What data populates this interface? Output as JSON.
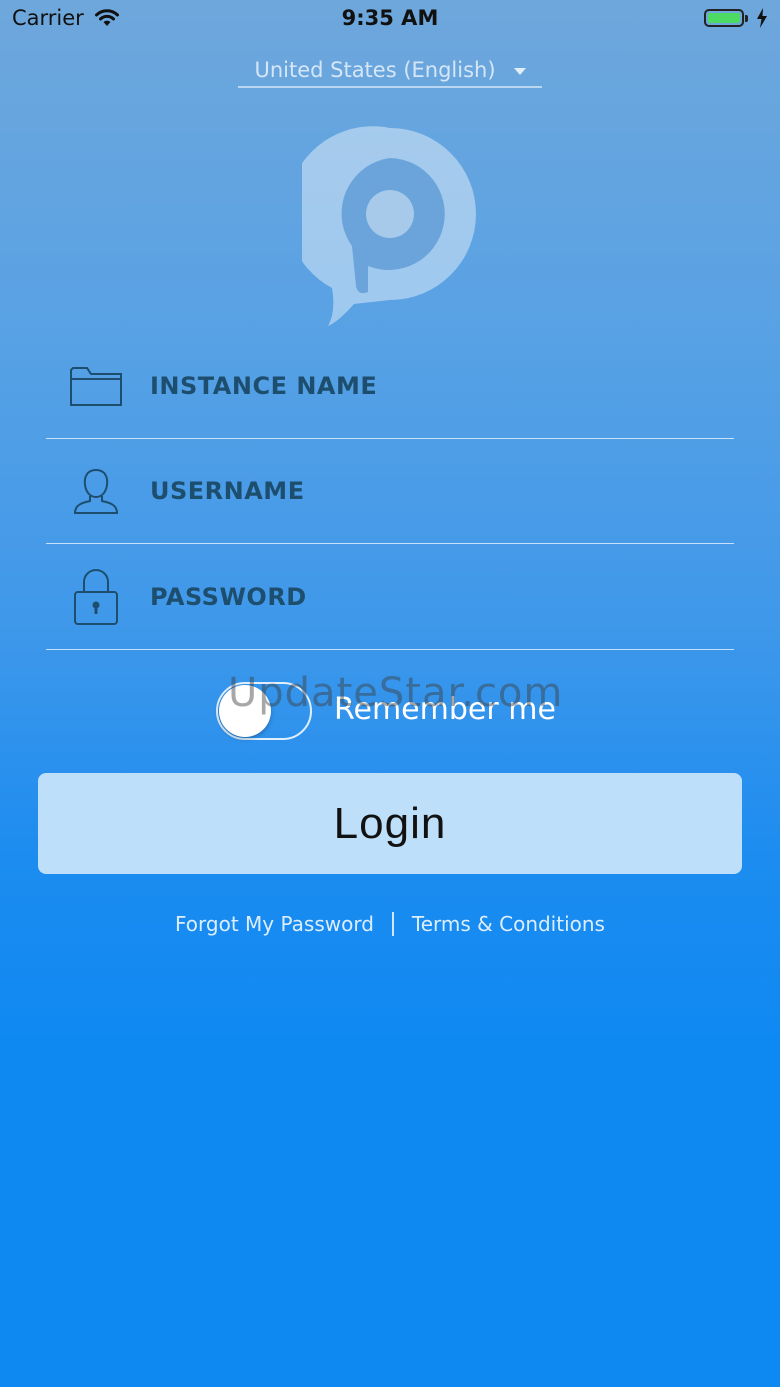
{
  "status_bar": {
    "carrier": "Carrier",
    "time": "9:35 AM",
    "battery_color": "#4cd964"
  },
  "language": {
    "selected": "United States (English)"
  },
  "logo": {
    "icon": "speech-pin-logo"
  },
  "form": {
    "instance_placeholder": "INSTANCE NAME",
    "username_placeholder": "USERNAME",
    "password_placeholder": "PASSWORD",
    "remember_label": "Remember me",
    "remember_on": false,
    "login_label": "Login"
  },
  "watermark": "UpdateStar.com",
  "links": {
    "forgot": "Forgot My Password",
    "terms": "Terms & Conditions"
  },
  "colors": {
    "field_text": "#1d4e6e",
    "login_bg": "#bddff9",
    "bg_top": "#6ea7db",
    "bg_bottom": "#0f89f2"
  }
}
